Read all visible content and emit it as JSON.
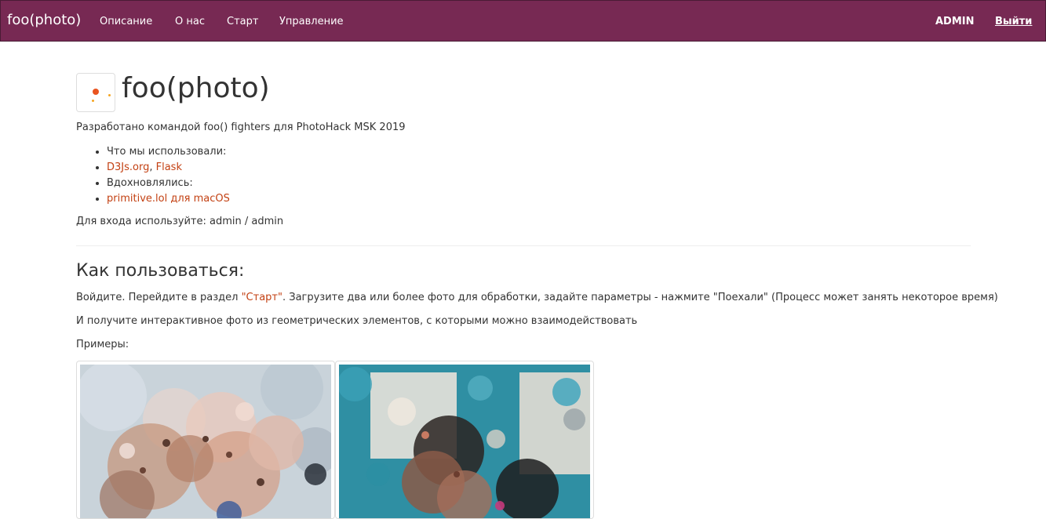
{
  "navbar": {
    "brand": "foo(photo)",
    "links": [
      "Описание",
      "О нас",
      "Старт",
      "Управление"
    ],
    "admin_label": "ADMIN",
    "logout_label": "Выйти"
  },
  "header": {
    "title": "foo(photo)"
  },
  "intro": {
    "developed_by": "Разработано командой foo() fighters для PhotoHack MSK 2019",
    "used_label": "Что мы использовали:",
    "link_d3": "D3Js.org",
    "comma": ", ",
    "link_flask": "Flask",
    "inspired_label": "Вдохновлялись:",
    "link_primitive": "primitive.lol для macOS",
    "login_hint": "Для входа используйте: admin / admin"
  },
  "how_to": {
    "heading": "Как пользоваться:",
    "step_prefix": "Войдите. Перейдите в раздел ",
    "step_link": "\"Старт\"",
    "step_suffix": ". Загрузите два или более фото для обработки, задайте параметры - нажмите \"Поехали\" (Процесс может занять некоторое время)",
    "result": "И получите интерактивное фото из геометрических элементов, с которыми можно взаимодействовать",
    "examples_label": "Примеры:"
  },
  "colors": {
    "navbar_bg": "#772953",
    "link": "#c34113",
    "logo_dot": "#e95420"
  }
}
